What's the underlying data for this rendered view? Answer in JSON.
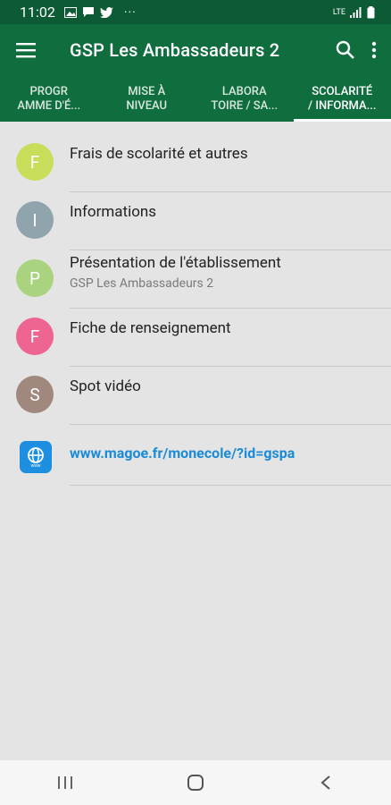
{
  "status": {
    "time": "11:02",
    "network": "LTE"
  },
  "appbar": {
    "title": "GSP Les Ambassadeurs 2"
  },
  "tabs": [
    {
      "label": "PROGR\nAMME D'É..."
    },
    {
      "label": "MISE À\nNIVEAU"
    },
    {
      "label": "LABORA\nTOIRE / SA..."
    },
    {
      "label": "SCOLARITÉ\n/ INFORMA..."
    }
  ],
  "list": [
    {
      "letter": "F",
      "color": "#c8de5a",
      "title": "Frais de scolarité et autres",
      "subtitle": ""
    },
    {
      "letter": "I",
      "color": "#90a4ae",
      "title": "Informations",
      "subtitle": ""
    },
    {
      "letter": "P",
      "color": "#a9d37e",
      "title": "Présentation de l'établissement",
      "subtitle": "GSP Les Ambassadeurs 2"
    },
    {
      "letter": "F",
      "color": "#ef6591",
      "title": "Fiche de renseignement",
      "subtitle": ""
    },
    {
      "letter": "S",
      "color": "#a1887f",
      "title": "Spot vidéo",
      "subtitle": ""
    }
  ],
  "link": {
    "url": "www.magoe.fr/monecole/?id=gspa",
    "icon": "www-globe-icon"
  },
  "colors": {
    "primary": "#0f6d3e",
    "status": "#0d5b35",
    "link": "#1b8bd8"
  }
}
